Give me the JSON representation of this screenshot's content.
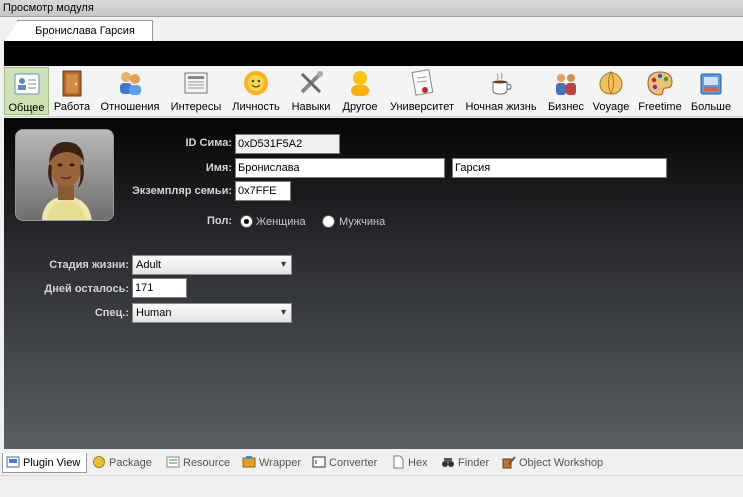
{
  "window": {
    "title": "Просмотр модуля"
  },
  "document_tab": {
    "label": "Бронислава Гарсия"
  },
  "toolbar": [
    {
      "label": "Общее",
      "icon": "general-card-icon",
      "active": true
    },
    {
      "label": "Работа",
      "icon": "work-door-icon"
    },
    {
      "label": "Отношения",
      "icon": "relationships-people-icon"
    },
    {
      "label": "Интересы",
      "icon": "interests-newspaper-icon"
    },
    {
      "label": "Личность",
      "icon": "personality-sun-icon"
    },
    {
      "label": "Навыки",
      "icon": "skills-tools-icon"
    },
    {
      "label": "Другое",
      "icon": "other-person-icon"
    },
    {
      "label": "Университет",
      "icon": "university-diploma-icon"
    },
    {
      "label": "Ночная жизнь",
      "icon": "nightlife-coffee-icon"
    },
    {
      "label": "Бизнес",
      "icon": "business-people-icon"
    },
    {
      "label": "Voyage",
      "icon": "voyage-shell-icon"
    },
    {
      "label": "Freetime",
      "icon": "freetime-palette-icon"
    },
    {
      "label": "Больше",
      "icon": "more-box-icon"
    }
  ],
  "form": {
    "sim_id": {
      "label": "ID Сима:",
      "value": "0xD531F5A2"
    },
    "name": {
      "label": "Имя:",
      "first": "Бронислава",
      "last": "Гарсия"
    },
    "family": {
      "label": "Экземпляр семьи:",
      "value": "0x7FFE"
    },
    "gender": {
      "label": "Пол:",
      "female": "Женщина",
      "male": "Мужчина",
      "selected": "female"
    },
    "life_stage": {
      "label": "Стадия жизни:",
      "value": "Adult"
    },
    "days_left": {
      "label": "Дней осталось:",
      "value": "171"
    },
    "species": {
      "label": "Спец.:",
      "value": "Human"
    }
  },
  "bottom_tabs": [
    {
      "label": "Plugin View",
      "icon": "plugin-view-icon",
      "active": true
    },
    {
      "label": "Package",
      "icon": "package-icon"
    },
    {
      "label": "Resource",
      "icon": "resource-list-icon"
    },
    {
      "label": "Wrapper",
      "icon": "wrapper-icon"
    },
    {
      "label": "Converter",
      "icon": "converter-icon"
    },
    {
      "label": "Hex",
      "icon": "hex-document-icon"
    },
    {
      "label": "Finder",
      "icon": "finder-binoculars-icon"
    },
    {
      "label": "Object Workshop",
      "icon": "object-workshop-icon"
    }
  ],
  "colors": {
    "active_tab_bg": "#cde1b4",
    "panel_top": "#050505",
    "panel_bottom": "#5a5e64"
  }
}
